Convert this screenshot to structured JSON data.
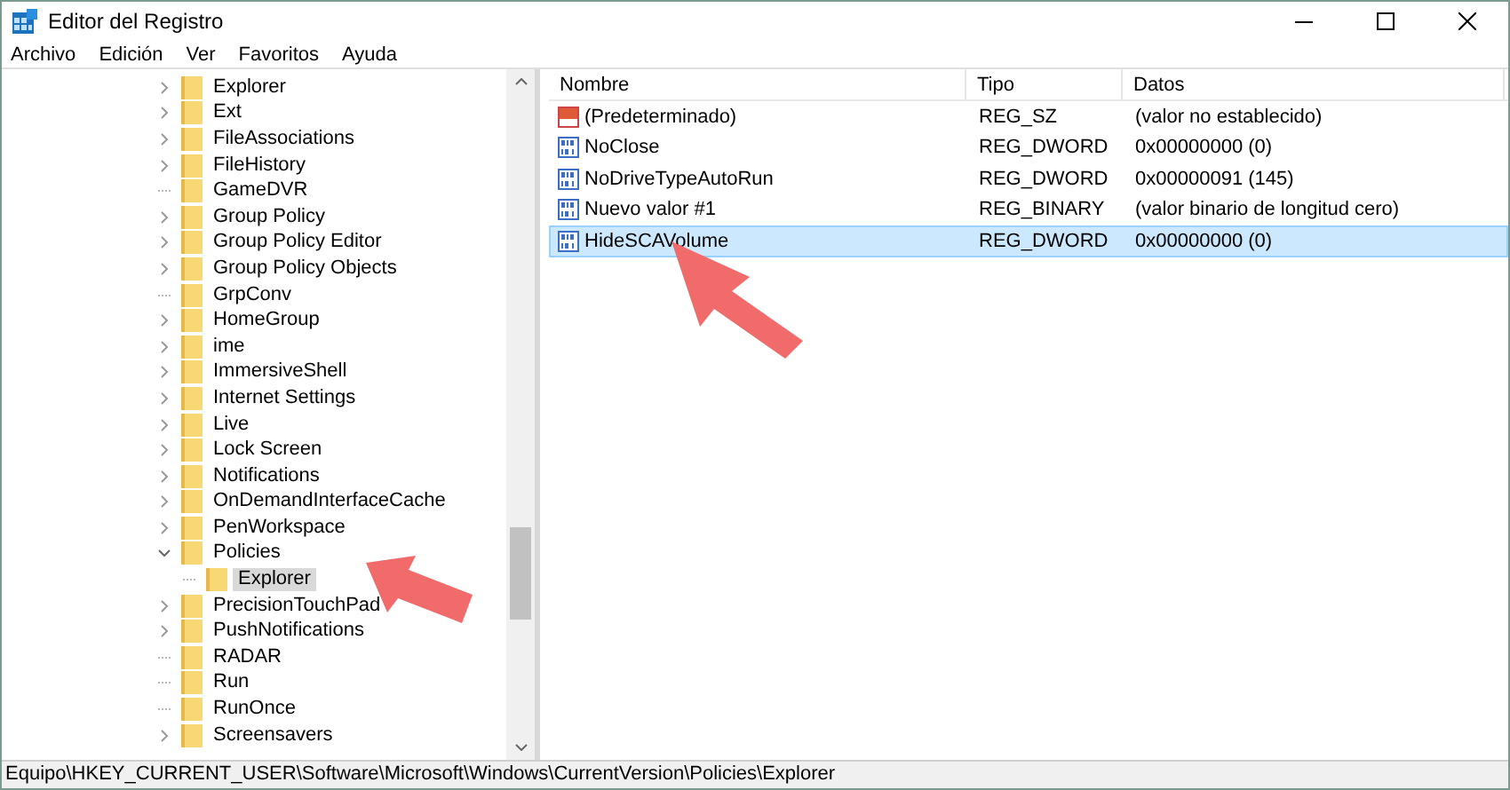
{
  "window": {
    "title": "Editor del Registro"
  },
  "menu": [
    {
      "label": "Archivo"
    },
    {
      "label": "Edición"
    },
    {
      "label": "Ver"
    },
    {
      "label": "Favoritos"
    },
    {
      "label": "Ayuda"
    }
  ],
  "tree": [
    {
      "label": "Explorer",
      "expanded": false,
      "selected": false
    },
    {
      "label": "Ext",
      "expanded": false,
      "selected": false
    },
    {
      "label": "FileAssociations",
      "expanded": false,
      "selected": false
    },
    {
      "label": "FileHistory",
      "expanded": false,
      "selected": false
    },
    {
      "label": "GameDVR",
      "selected": false
    },
    {
      "label": "Group Policy",
      "expanded": false,
      "selected": false
    },
    {
      "label": "Group Policy Editor",
      "expanded": false,
      "selected": false
    },
    {
      "label": "Group Policy Objects",
      "expanded": false,
      "selected": false
    },
    {
      "label": "GrpConv",
      "selected": false
    },
    {
      "label": "HomeGroup",
      "expanded": false,
      "selected": false
    },
    {
      "label": "ime",
      "expanded": false,
      "selected": false
    },
    {
      "label": "ImmersiveShell",
      "expanded": false,
      "selected": false
    },
    {
      "label": "Internet Settings",
      "expanded": false,
      "selected": false
    },
    {
      "label": "Live",
      "expanded": false,
      "selected": false
    },
    {
      "label": "Lock Screen",
      "expanded": false,
      "selected": false
    },
    {
      "label": "Notifications",
      "expanded": false,
      "selected": false
    },
    {
      "label": "OnDemandInterfaceCache",
      "expanded": false,
      "selected": false
    },
    {
      "label": "PenWorkspace",
      "expanded": false,
      "selected": false
    },
    {
      "label": "Policies",
      "expanded": true,
      "selected": false,
      "children": [
        {
          "label": "Explorer",
          "selected": true
        }
      ]
    },
    {
      "label": "PrecisionTouchPad",
      "expanded": false,
      "selected": false
    },
    {
      "label": "PushNotifications",
      "expanded": false,
      "selected": false
    },
    {
      "label": "RADAR",
      "selected": false
    },
    {
      "label": "Run",
      "selected": false
    },
    {
      "label": "RunOnce",
      "selected": false
    },
    {
      "label": "Screensavers",
      "expanded": false,
      "selected": false
    }
  ],
  "table": {
    "columns": [
      "Nombre",
      "Tipo",
      "Datos"
    ],
    "rows": [
      {
        "kind": "string",
        "name": "(Predeterminado)",
        "type": "REG_SZ",
        "data": "(valor no establecido)",
        "selected": false
      },
      {
        "kind": "binary",
        "name": "NoClose",
        "type": "REG_DWORD",
        "data": "0x00000000 (0)",
        "selected": false
      },
      {
        "kind": "binary",
        "name": "NoDriveTypeAutoRun",
        "type": "REG_DWORD",
        "data": "0x00000091 (145)",
        "selected": false
      },
      {
        "kind": "binary",
        "name": "Nuevo valor #1",
        "type": "REG_BINARY",
        "data": "(valor binario de longitud cero)",
        "selected": false
      },
      {
        "kind": "binary",
        "name": "HideSCAVolume",
        "type": "REG_DWORD",
        "data": "0x00000000 (0)",
        "selected": true
      }
    ]
  },
  "status_bar": "Equipo\\HKEY_CURRENT_USER\\Software\\Microsoft\\Windows\\CurrentVersion\\Policies\\Explorer"
}
